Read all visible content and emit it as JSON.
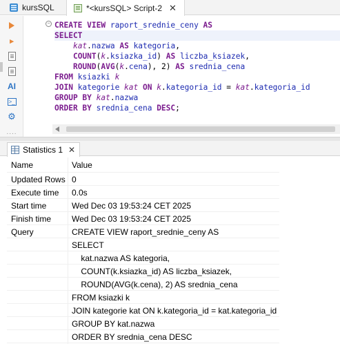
{
  "tabs": [
    {
      "label": "kursSQL",
      "icon": "database-icon"
    },
    {
      "label": "*<kursSQL> Script-2",
      "icon": "sql-script-icon"
    }
  ],
  "toolbar": {
    "icons": [
      "execute-statement-icon",
      "execute-script-icon",
      "explain-plan-icon",
      "load-history-icon",
      "ai-assist-icon",
      "terminal-icon",
      "settings-icon",
      "more-icon"
    ],
    "ai_label": "AI",
    "more_label": "....",
    "fold_label": "−"
  },
  "editor": {
    "lines": [
      [
        {
          "t": "CREATE VIEW ",
          "c": "kw"
        },
        {
          "t": "raport_srednie_ceny ",
          "c": "id"
        },
        {
          "t": "AS",
          "c": "kw"
        }
      ],
      [
        {
          "t": "SELECT",
          "c": "kw"
        }
      ],
      [
        {
          "t": "    ",
          "c": "pn"
        },
        {
          "t": "kat",
          "c": "al"
        },
        {
          "t": ".",
          "c": "pn"
        },
        {
          "t": "nazwa ",
          "c": "id"
        },
        {
          "t": "AS ",
          "c": "kw"
        },
        {
          "t": "kategoria",
          "c": "id"
        },
        {
          "t": ",",
          "c": "pn"
        }
      ],
      [
        {
          "t": "    ",
          "c": "pn"
        },
        {
          "t": "COUNT",
          "c": "fn"
        },
        {
          "t": "(",
          "c": "pn"
        },
        {
          "t": "k",
          "c": "al"
        },
        {
          "t": ".",
          "c": "pn"
        },
        {
          "t": "ksiazka_id",
          "c": "id"
        },
        {
          "t": ") ",
          "c": "pn"
        },
        {
          "t": "AS ",
          "c": "kw"
        },
        {
          "t": "liczba_ksiazek",
          "c": "id"
        },
        {
          "t": ",",
          "c": "pn"
        }
      ],
      [
        {
          "t": "    ",
          "c": "pn"
        },
        {
          "t": "ROUND",
          "c": "fn"
        },
        {
          "t": "(",
          "c": "pn"
        },
        {
          "t": "AVG",
          "c": "fn"
        },
        {
          "t": "(",
          "c": "pn"
        },
        {
          "t": "k",
          "c": "al"
        },
        {
          "t": ".",
          "c": "pn"
        },
        {
          "t": "cena",
          "c": "id"
        },
        {
          "t": "), 2) ",
          "c": "pn"
        },
        {
          "t": "AS ",
          "c": "kw"
        },
        {
          "t": "srednia_cena",
          "c": "id"
        }
      ],
      [
        {
          "t": "FROM ",
          "c": "kw"
        },
        {
          "t": "ksiazki ",
          "c": "id"
        },
        {
          "t": "k",
          "c": "al"
        }
      ],
      [
        {
          "t": "JOIN ",
          "c": "kw"
        },
        {
          "t": "kategorie ",
          "c": "id"
        },
        {
          "t": "kat ",
          "c": "al"
        },
        {
          "t": "ON ",
          "c": "kw"
        },
        {
          "t": "k",
          "c": "al"
        },
        {
          "t": ".",
          "c": "pn"
        },
        {
          "t": "kategoria_id ",
          "c": "id"
        },
        {
          "t": "= ",
          "c": "pn"
        },
        {
          "t": "kat",
          "c": "al"
        },
        {
          "t": ".",
          "c": "pn"
        },
        {
          "t": "kategoria_id",
          "c": "id"
        }
      ],
      [
        {
          "t": "GROUP BY ",
          "c": "kw"
        },
        {
          "t": "kat",
          "c": "al"
        },
        {
          "t": ".",
          "c": "pn"
        },
        {
          "t": "nazwa",
          "c": "id"
        }
      ],
      [
        {
          "t": "ORDER BY ",
          "c": "kw"
        },
        {
          "t": "srednia_cena ",
          "c": "id"
        },
        {
          "t": "DESC",
          "c": "kw"
        },
        {
          "t": ";",
          "c": "pn"
        }
      ]
    ]
  },
  "results": {
    "tab_label": "Statistics 1",
    "tab_close": "✕",
    "header": {
      "name": "Name",
      "value": "Value"
    },
    "rows": [
      {
        "name": "Updated Rows",
        "value": "0"
      },
      {
        "name": "Execute time",
        "value": "0.0s"
      },
      {
        "name": "Start time",
        "value": "Wed Dec 03 19:53:24 CET 2025"
      },
      {
        "name": "Finish time",
        "value": "Wed Dec 03 19:53:24 CET 2025"
      },
      {
        "name": "Query",
        "value": "CREATE VIEW raport_srednie_ceny AS"
      },
      {
        "name": "",
        "value": "SELECT"
      },
      {
        "name": "",
        "value": "    kat.nazwa AS kategoria,"
      },
      {
        "name": "",
        "value": "    COUNT(k.ksiazka_id) AS liczba_ksiazek,"
      },
      {
        "name": "",
        "value": "    ROUND(AVG(k.cena), 2) AS srednia_cena"
      },
      {
        "name": "",
        "value": "FROM ksiazki k"
      },
      {
        "name": "",
        "value": "JOIN kategorie kat ON k.kategoria_id = kat.kategoria_id"
      },
      {
        "name": "",
        "value": "GROUP BY kat.nazwa"
      },
      {
        "name": "",
        "value": "ORDER BY srednia_cena DESC"
      }
    ]
  },
  "colors": {
    "keyword": "#7b1c8e",
    "identifier": "#1c2ab0",
    "accent": "#e8883a"
  }
}
